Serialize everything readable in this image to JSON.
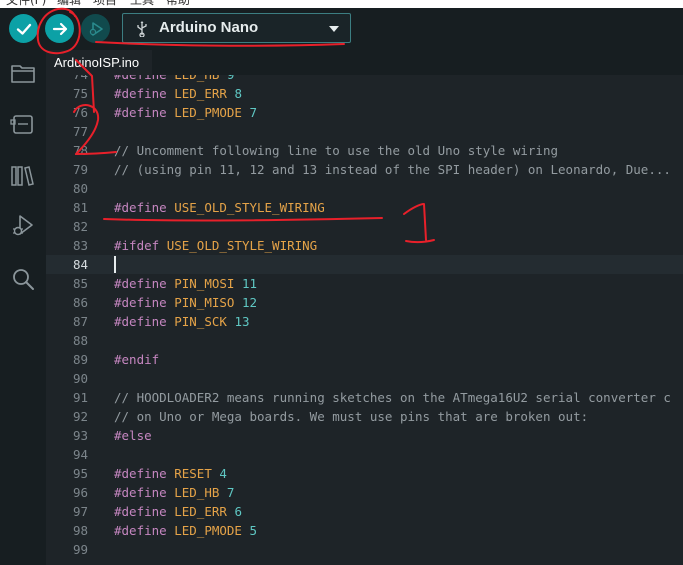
{
  "menubar": {
    "items": [
      "文件(F)",
      "编辑",
      "项目",
      "工具",
      "帮助"
    ]
  },
  "toolbar": {
    "verify_icon": "check-icon",
    "upload_icon": "arrow-right-icon",
    "debug_icon": "debug-icon",
    "board": {
      "usb_icon": "usb-icon",
      "name": "Arduino Nano"
    }
  },
  "sidebar": {
    "items": [
      "folder-icon",
      "board-manager-icon",
      "library-icon",
      "debug-icon",
      "search-icon"
    ]
  },
  "tabs": [
    {
      "label": "ArduinoISP.ino",
      "active": true
    }
  ],
  "editor": {
    "current_line": 84,
    "lines": [
      {
        "n": "74",
        "segs": [
          [
            "kw",
            "#define "
          ],
          [
            "ident",
            "LED_HB "
          ],
          [
            "num",
            "9"
          ]
        ]
      },
      {
        "n": "75",
        "segs": [
          [
            "kw",
            "#define "
          ],
          [
            "ident",
            "LED_ERR "
          ],
          [
            "num",
            "8"
          ]
        ]
      },
      {
        "n": "76",
        "segs": [
          [
            "kw",
            "#define "
          ],
          [
            "ident",
            "LED_PMODE "
          ],
          [
            "num",
            "7"
          ]
        ]
      },
      {
        "n": "77",
        "segs": []
      },
      {
        "n": "78",
        "segs": [
          [
            "cmt",
            "// Uncomment following line to use the old Uno style wiring"
          ]
        ]
      },
      {
        "n": "79",
        "segs": [
          [
            "cmt",
            "// (using pin 11, 12 and 13 instead of the SPI header) on Leonardo, Due..."
          ]
        ]
      },
      {
        "n": "80",
        "segs": []
      },
      {
        "n": "81",
        "segs": [
          [
            "kw",
            "#define "
          ],
          [
            "ident",
            "USE_OLD_STYLE_WIRING"
          ]
        ]
      },
      {
        "n": "82",
        "segs": []
      },
      {
        "n": "83",
        "segs": [
          [
            "kw",
            "#ifdef "
          ],
          [
            "ident",
            "USE_OLD_STYLE_WIRING"
          ]
        ]
      },
      {
        "n": "84",
        "segs": []
      },
      {
        "n": "85",
        "segs": [
          [
            "kw",
            "#define "
          ],
          [
            "ident",
            "PIN_MOSI "
          ],
          [
            "num",
            "11"
          ]
        ]
      },
      {
        "n": "86",
        "segs": [
          [
            "kw",
            "#define "
          ],
          [
            "ident",
            "PIN_MISO "
          ],
          [
            "num",
            "12"
          ]
        ]
      },
      {
        "n": "87",
        "segs": [
          [
            "kw",
            "#define "
          ],
          [
            "ident",
            "PIN_SCK "
          ],
          [
            "num",
            "13"
          ]
        ]
      },
      {
        "n": "88",
        "segs": []
      },
      {
        "n": "89",
        "segs": [
          [
            "kw",
            "#endif"
          ]
        ]
      },
      {
        "n": "90",
        "segs": []
      },
      {
        "n": "91",
        "segs": [
          [
            "cmt",
            "// HOODLOADER2 means running sketches on the ATmega16U2 serial converter c"
          ]
        ]
      },
      {
        "n": "92",
        "segs": [
          [
            "cmt",
            "// on Uno or Mega boards. We must use pins that are broken out:"
          ]
        ]
      },
      {
        "n": "93",
        "segs": [
          [
            "kw",
            "#else"
          ]
        ]
      },
      {
        "n": "94",
        "segs": []
      },
      {
        "n": "95",
        "segs": [
          [
            "kw",
            "#define "
          ],
          [
            "ident",
            "RESET "
          ],
          [
            "num",
            "4"
          ]
        ]
      },
      {
        "n": "96",
        "segs": [
          [
            "kw",
            "#define "
          ],
          [
            "ident",
            "LED_HB "
          ],
          [
            "num",
            "7"
          ]
        ]
      },
      {
        "n": "97",
        "segs": [
          [
            "kw",
            "#define "
          ],
          [
            "ident",
            "LED_ERR "
          ],
          [
            "num",
            "6"
          ]
        ]
      },
      {
        "n": "98",
        "segs": [
          [
            "kw",
            "#define "
          ],
          [
            "ident",
            "LED_PMODE "
          ],
          [
            "num",
            "5"
          ]
        ]
      },
      {
        "n": "99",
        "segs": []
      }
    ]
  },
  "annotations": {
    "color": "#e8202a",
    "labels": [
      "1",
      "2",
      "1"
    ]
  },
  "colors": {
    "accent": "#0ca1a6",
    "keyword": "#c586c0",
    "identifier": "#e5a348",
    "number": "#5fc7c3",
    "comment": "#939ba0"
  }
}
